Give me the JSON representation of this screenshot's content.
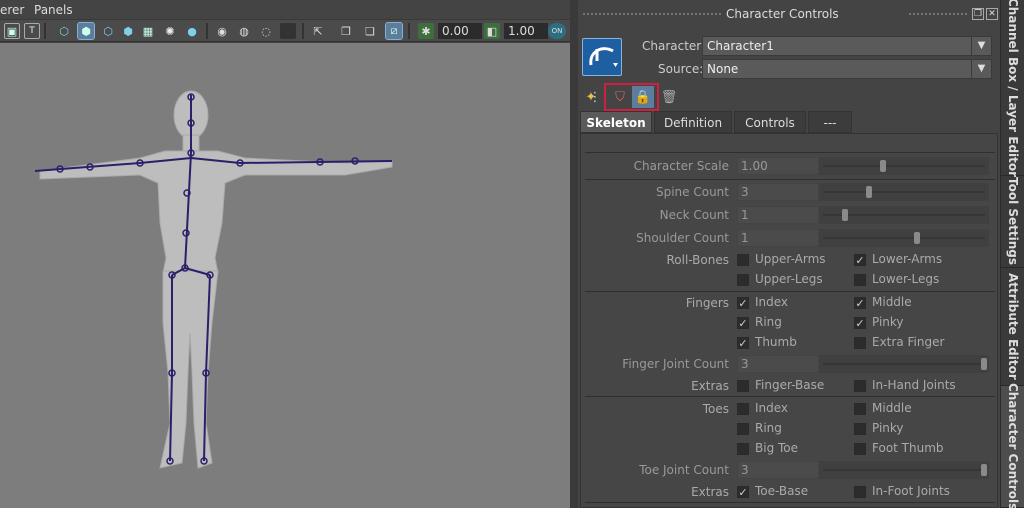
{
  "menu": {
    "item1": "erer",
    "item2": "Panels"
  },
  "toolbar": {
    "field1": "0.00",
    "field2": "1.00",
    "toggle_label": "ON"
  },
  "panel": {
    "title": "Character Controls",
    "character_label": "Character:",
    "character_value": "Character1",
    "source_label": "Source:",
    "source_value": "None"
  },
  "tabs": [
    {
      "label": "Skeleton",
      "active": true
    },
    {
      "label": "Definition",
      "active": false
    },
    {
      "label": "Controls",
      "active": false
    },
    {
      "label": "---",
      "active": false
    }
  ],
  "skeleton": {
    "character_scale": {
      "label": "Character Scale",
      "value": "1.00",
      "slider_fraction": 0.37
    },
    "spine_count": {
      "label": "Spine Count",
      "value": "3",
      "slider_fraction": 0.28
    },
    "neck_count": {
      "label": "Neck Count",
      "value": "1",
      "slider_fraction": 0.13
    },
    "shoulder_count": {
      "label": "Shoulder Count",
      "value": "1",
      "slider_fraction": 0.58
    },
    "roll_bones": {
      "label": "Roll-Bones",
      "options": [
        {
          "label": "Upper-Arms",
          "checked": false
        },
        {
          "label": "Lower-Arms",
          "checked": true
        },
        {
          "label": "Upper-Legs",
          "checked": false
        },
        {
          "label": "Lower-Legs",
          "checked": false
        }
      ]
    },
    "fingers": {
      "label": "Fingers",
      "options": [
        {
          "label": "Index",
          "checked": true
        },
        {
          "label": "Middle",
          "checked": true
        },
        {
          "label": "Ring",
          "checked": true
        },
        {
          "label": "Pinky",
          "checked": true
        },
        {
          "label": "Thumb",
          "checked": true
        },
        {
          "label": "Extra Finger",
          "checked": false
        }
      ]
    },
    "finger_joint_count": {
      "label": "Finger Joint Count",
      "value": "3",
      "slider_fraction": 1.0
    },
    "finger_extras": {
      "label": "Extras",
      "options": [
        {
          "label": "Finger-Base",
          "checked": false
        },
        {
          "label": "In-Hand Joints",
          "checked": false
        }
      ]
    },
    "toes": {
      "label": "Toes",
      "options": [
        {
          "label": "Index",
          "checked": false
        },
        {
          "label": "Middle",
          "checked": false
        },
        {
          "label": "Ring",
          "checked": false
        },
        {
          "label": "Pinky",
          "checked": false
        },
        {
          "label": "Big Toe",
          "checked": false
        },
        {
          "label": "Foot Thumb",
          "checked": false
        }
      ]
    },
    "toe_joint_count": {
      "label": "Toe Joint Count",
      "value": "3",
      "slider_fraction": 1.0
    },
    "toe_extras": {
      "label": "Extras",
      "options": [
        {
          "label": "Toe-Base",
          "checked": true
        },
        {
          "label": "In-Foot Joints",
          "checked": false
        }
      ]
    }
  },
  "side_tabs": [
    {
      "label": "Channel Box / Layer Editor",
      "active": false
    },
    {
      "label": "Tool Settings",
      "active": false
    },
    {
      "label": "Attribute Editor",
      "active": false
    },
    {
      "label": "Character Controls",
      "active": true
    }
  ],
  "colors": {
    "highlight_box": "#d02040",
    "selected_button": "#5c7e9c",
    "viewport_bg": "#7d7d7d"
  }
}
